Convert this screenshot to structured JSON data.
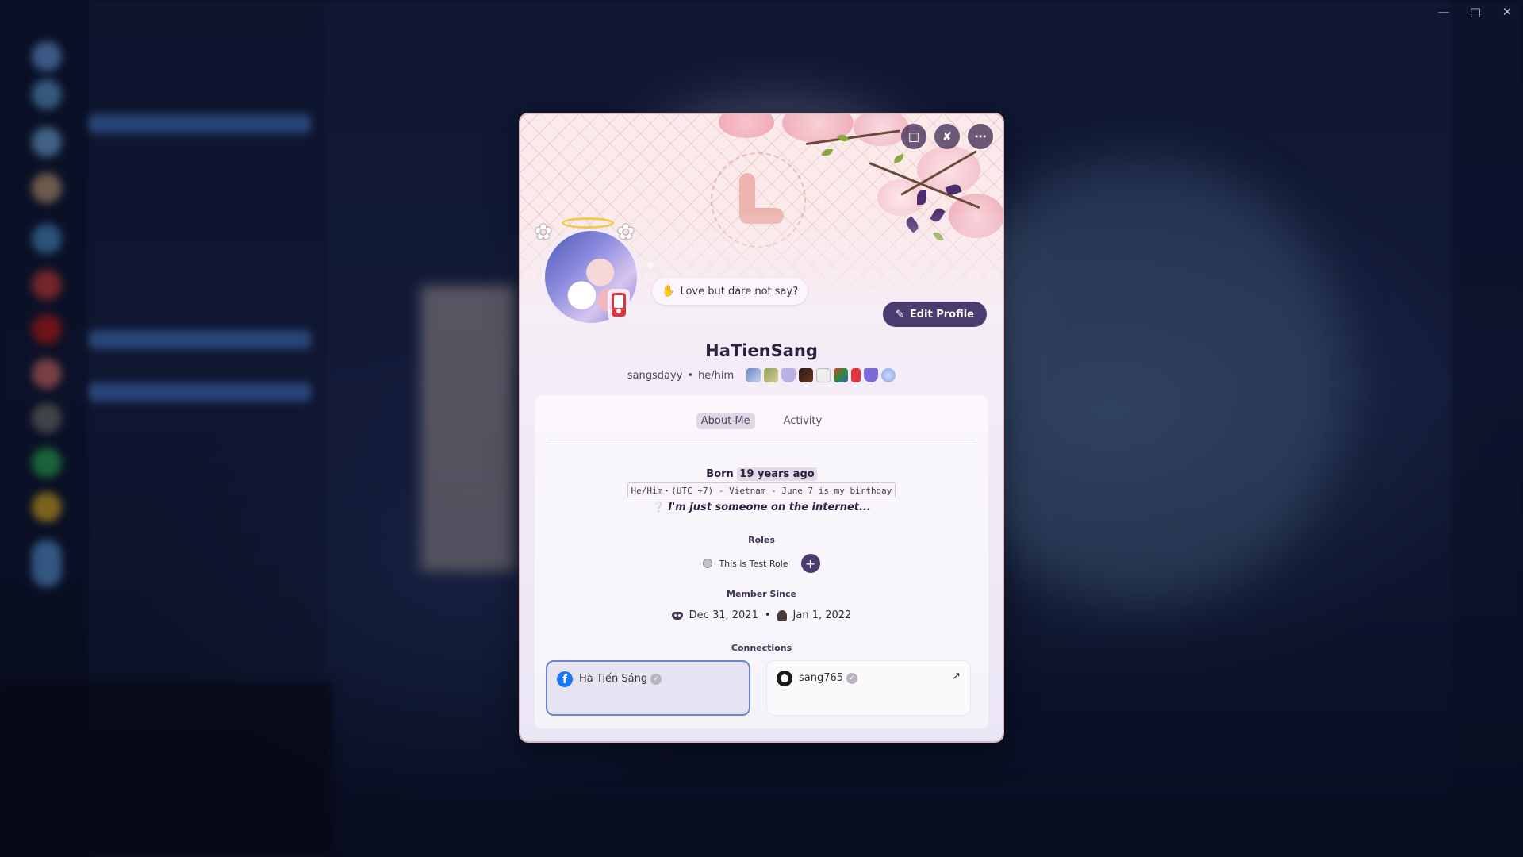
{
  "profile": {
    "display_name": "HaTienSang",
    "username": "sangsdayy",
    "pronouns": "he/him",
    "separator": "•",
    "custom_status": "Love but dare not say?",
    "edit_label": "Edit Profile"
  },
  "tabs": [
    {
      "label": "About Me",
      "active": true
    },
    {
      "label": "Activity",
      "active": false
    }
  ],
  "about": {
    "born_label": "Born",
    "born_value": "19 years ago",
    "info_line": "He/Him・(UTC +7) - Vietnam - June 7 is my birthday",
    "quote": "I'm just someone on the internet..."
  },
  "roles": {
    "title": "Roles",
    "items": [
      {
        "label": "This is Test Role",
        "color": "#c4c0c9"
      }
    ],
    "add_label": "+"
  },
  "member_since": {
    "title": "Member Since",
    "discord_date": "Dec 31, 2021",
    "server_date": "Jan 1, 2022"
  },
  "connections": {
    "title": "Connections",
    "items": [
      {
        "service": "facebook",
        "name": "Hà Tiến Sáng",
        "verified": true
      },
      {
        "service": "github",
        "name": "sang765",
        "verified": true
      }
    ]
  },
  "icons": {
    "nitro": "nitro-icon",
    "boost": "boost-icon",
    "more": "more-icon",
    "close": "close-window-icon"
  },
  "colors": {
    "accent": "#4a3c6e",
    "banner_pink": "#fbeaea",
    "facebook": "#1877f2"
  }
}
